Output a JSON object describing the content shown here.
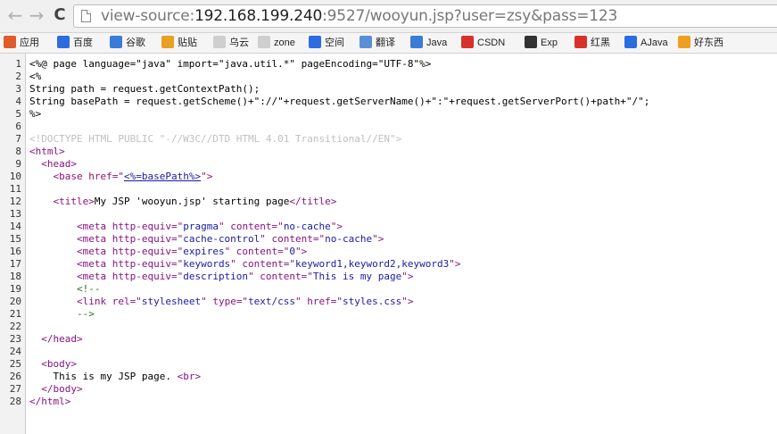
{
  "nav": {
    "back_glyph": "←",
    "forward_glyph": "→",
    "reload_glyph": "C"
  },
  "address": {
    "prefix": "view-source:",
    "host": "192.168.199.240",
    "rest": ":9527/wooyun.jsp?user=zsy&pass=123"
  },
  "bookmarks": [
    {
      "label": "应用",
      "icon": "apps-grid-icon",
      "color": "#e05a2a"
    },
    {
      "label": "百度",
      "icon": "baidu-icon",
      "color": "#2b6de0"
    },
    {
      "label": "谷歌",
      "icon": "google-icon",
      "color": "#3b7bd8"
    },
    {
      "label": "贴贴",
      "icon": "tieba-icon",
      "color": "#e8a020"
    },
    {
      "label": "乌云",
      "icon": "folder-page-icon",
      "color": "#cfcfcf"
    },
    {
      "label": "zone",
      "icon": "folder-page-icon",
      "color": "#cfcfcf"
    },
    {
      "label": "空间",
      "icon": "qzone-icon",
      "color": "#2b6de0"
    },
    {
      "label": "翻译",
      "icon": "translate-icon",
      "color": "#5a8fd8"
    },
    {
      "label": "Java",
      "icon": "java-g-icon",
      "color": "#3b7bd8"
    },
    {
      "label": "CSDN",
      "icon": "csdn-icon",
      "color": "#d9302b"
    },
    {
      "label": "Exp",
      "icon": "exp-icon",
      "color": "#333333"
    },
    {
      "label": "红黑",
      "icon": "redblack-icon",
      "color": "#d9302b"
    },
    {
      "label": "AJava",
      "icon": "ajava-icon",
      "color": "#2b6de0"
    },
    {
      "label": "好东西",
      "icon": "good-stuff-icon",
      "color": "#f0a020"
    }
  ],
  "source_lines": [
    "1",
    "2",
    "3",
    "4",
    "5",
    "6",
    "7",
    "8",
    "9",
    "10",
    "11",
    "12",
    "13",
    "14",
    "15",
    "16",
    "17",
    "18",
    "19",
    "20",
    "21",
    "22",
    "23",
    "24",
    "25",
    "26",
    "27",
    "28"
  ],
  "code": {
    "l1": "<%@ page language=\"java\" import=\"java.util.*\" pageEncoding=\"UTF-8\"%>",
    "l2": "<%",
    "l3": "String path = request.getContextPath();",
    "l4": "String basePath = request.getScheme()+\"://\"+request.getServerName()+\":\"+request.getServerPort()+path+\"/\";",
    "l5": "%>",
    "l7": "<!DOCTYPE HTML PUBLIC \"-//W3C//DTD HTML 4.01 Transitional//EN\">",
    "l8_tag": "<html>",
    "l9_tag": "<head>",
    "l10_open": "<base href=\"",
    "l10_link": "<%=basePath%>",
    "l10_close": "\">",
    "l12_open": "<title>",
    "l12_text": "My JSP 'wooyun.jsp' starting page",
    "l12_close": "</title>",
    "l14": [
      "<meta http-equiv=\"",
      "pragma",
      "\" content=\"",
      "no-cache",
      "\">"
    ],
    "l15": [
      "<meta http-equiv=\"",
      "cache-control",
      "\" content=\"",
      "no-cache",
      "\">"
    ],
    "l16": [
      "<meta http-equiv=\"",
      "expires",
      "\" content=\"",
      "0",
      "\">"
    ],
    "l17": [
      "<meta http-equiv=\"",
      "keywords",
      "\" content=\"",
      "keyword1,keyword2,keyword3",
      "\">"
    ],
    "l18": [
      "<meta http-equiv=\"",
      "description",
      "\" content=\"",
      "This is my page",
      "\">"
    ],
    "l19": "<!--",
    "l20": [
      "<link rel=\"",
      "stylesheet",
      "\" type=\"",
      "text/css",
      "\" href=\"",
      "styles.css",
      "\">"
    ],
    "l21": "-->",
    "l23": "</head>",
    "l25": "<body>",
    "l26_text": "This is my JSP page. ",
    "l26_tag": "<br>",
    "l27": "</body>",
    "l28": "</html>"
  }
}
